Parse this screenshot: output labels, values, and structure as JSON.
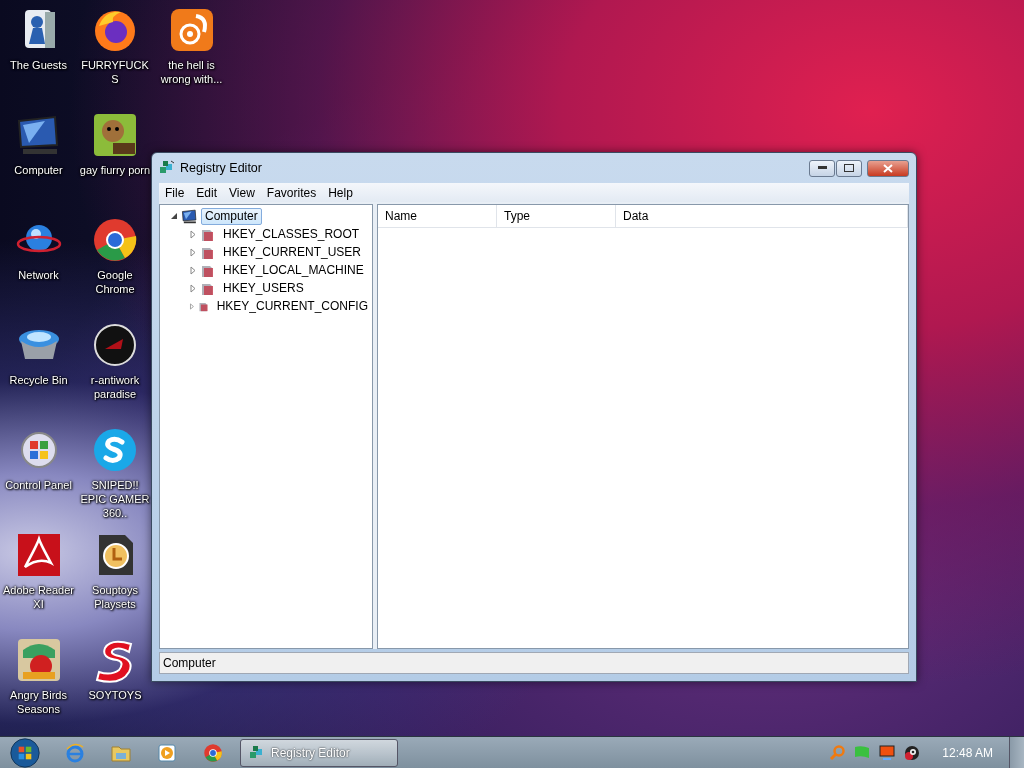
{
  "desktop_icons": [
    {
      "label": "The Guests",
      "kind": "user"
    },
    {
      "label": "FURRYFUCKS",
      "kind": "firefox"
    },
    {
      "label": "the hell is wrong with...",
      "kind": "squirrel"
    },
    {
      "label": "Computer",
      "kind": "computer"
    },
    {
      "label": "gay fiurry porn",
      "kind": "game"
    },
    {
      "label": "Network",
      "kind": "network"
    },
    {
      "label": "Google Chrome",
      "kind": "chrome"
    },
    {
      "label": "Recycle Bin",
      "kind": "recycle"
    },
    {
      "label": "r-antiwork paradise",
      "kind": "darkcircle"
    },
    {
      "label": "Control Panel",
      "kind": "control"
    },
    {
      "label": "SNIPED!! EPIC GAMER 360..",
      "kind": "skype"
    },
    {
      "label": "Adobe Reader XI",
      "kind": "pdf"
    },
    {
      "label": "Souptoys Playsets",
      "kind": "clock"
    },
    {
      "label": "Angry Birds Seasons",
      "kind": "bird"
    },
    {
      "label": "SOYTOYS",
      "kind": "sletter"
    }
  ],
  "window": {
    "title": "Registry Editor",
    "menu": [
      "File",
      "Edit",
      "View",
      "Favorites",
      "Help"
    ],
    "tree": [
      {
        "label": "Computer",
        "kind": "computer",
        "expanded": true,
        "selected": true,
        "children": [
          {
            "label": "HKEY_CLASSES_ROOT",
            "kind": "folder",
            "expanded": false,
            "selected": false
          },
          {
            "label": "HKEY_CURRENT_USER",
            "kind": "folder",
            "expanded": false,
            "selected": false
          },
          {
            "label": "HKEY_LOCAL_MACHINE",
            "kind": "folder",
            "expanded": false,
            "selected": false
          },
          {
            "label": "HKEY_USERS",
            "kind": "folder",
            "expanded": false,
            "selected": false
          },
          {
            "label": "HKEY_CURRENT_CONFIG",
            "kind": "folder",
            "expanded": false,
            "selected": false
          }
        ]
      }
    ],
    "columns": [
      "Name",
      "Type",
      "Data"
    ],
    "status_bar": "Computer"
  },
  "taskbar": {
    "task_buttons": [
      {
        "label": "Registry Editor",
        "selected": true
      }
    ],
    "clock": "12:48 AM"
  }
}
